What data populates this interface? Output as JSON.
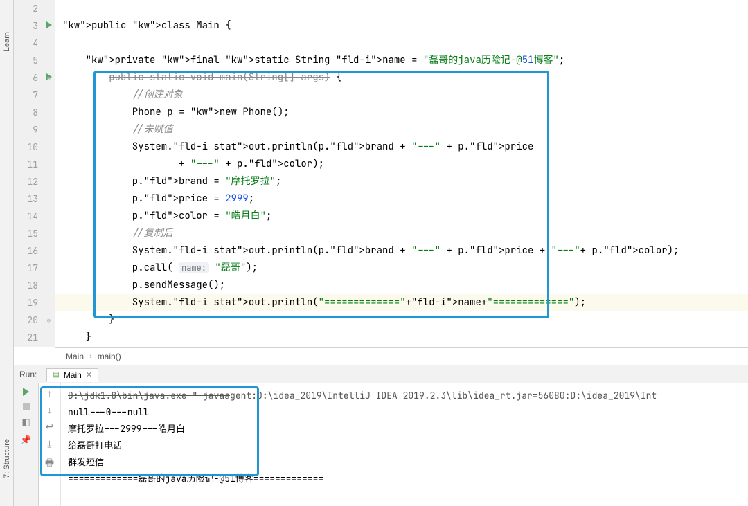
{
  "sidebar": {
    "learn": "Learn",
    "structure": "7: Structure"
  },
  "code": {
    "lines": [
      {
        "n": "2",
        "c": ""
      },
      {
        "n": "3",
        "c": "public class Main {",
        "run": true
      },
      {
        "n": "4",
        "c": ""
      },
      {
        "n": "5",
        "c": "    private final static String name = \"磊哥的java历险记-@51博客\";"
      },
      {
        "n": "6",
        "c": "        public static void main(String[] args) {",
        "run": true,
        "fold": true
      },
      {
        "n": "7",
        "c": "            //创建对象"
      },
      {
        "n": "8",
        "c": "            Phone p = new Phone();"
      },
      {
        "n": "9",
        "c": "            //未赋值"
      },
      {
        "n": "10",
        "c": "            System.out.println(p.brand + \"---\" + p.price"
      },
      {
        "n": "11",
        "c": "                    + \"---\" + p.color);"
      },
      {
        "n": "12",
        "c": "            p.brand = \"摩托罗拉\";"
      },
      {
        "n": "13",
        "c": "            p.price = 2999;"
      },
      {
        "n": "14",
        "c": "            p.color = \"皓月白\";"
      },
      {
        "n": "15",
        "c": "            //复制后"
      },
      {
        "n": "16",
        "c": "            System.out.println(p.brand + \"---\" + p.price + \"---\"+ p.color);"
      },
      {
        "n": "17",
        "c": "            p.call( name: \"磊哥\");"
      },
      {
        "n": "18",
        "c": "            p.sendMessage();"
      },
      {
        "n": "19",
        "c": "            System.out.println(\"=============\"+name+\"=============\");",
        "hl": true
      },
      {
        "n": "20",
        "c": "        }",
        "fold": true
      },
      {
        "n": "21",
        "c": "    }"
      }
    ]
  },
  "breadcrumbs": {
    "a": "Main",
    "b": "main()"
  },
  "run": {
    "label": "Run:",
    "tab": "Main",
    "output": [
      "D:\\jdk1.8\\bin\\java.exe \"-javaagent:D:\\idea_2019\\IntelliJ IDEA 2019.2.3\\lib\\idea_rt.jar=56080:D:\\idea_2019\\Int",
      "null---0---null",
      "摩托罗拉---2999---皓月白",
      "给磊哥打电话",
      "群发短信",
      "=============磊哥的java历险记-@51博客============="
    ]
  }
}
